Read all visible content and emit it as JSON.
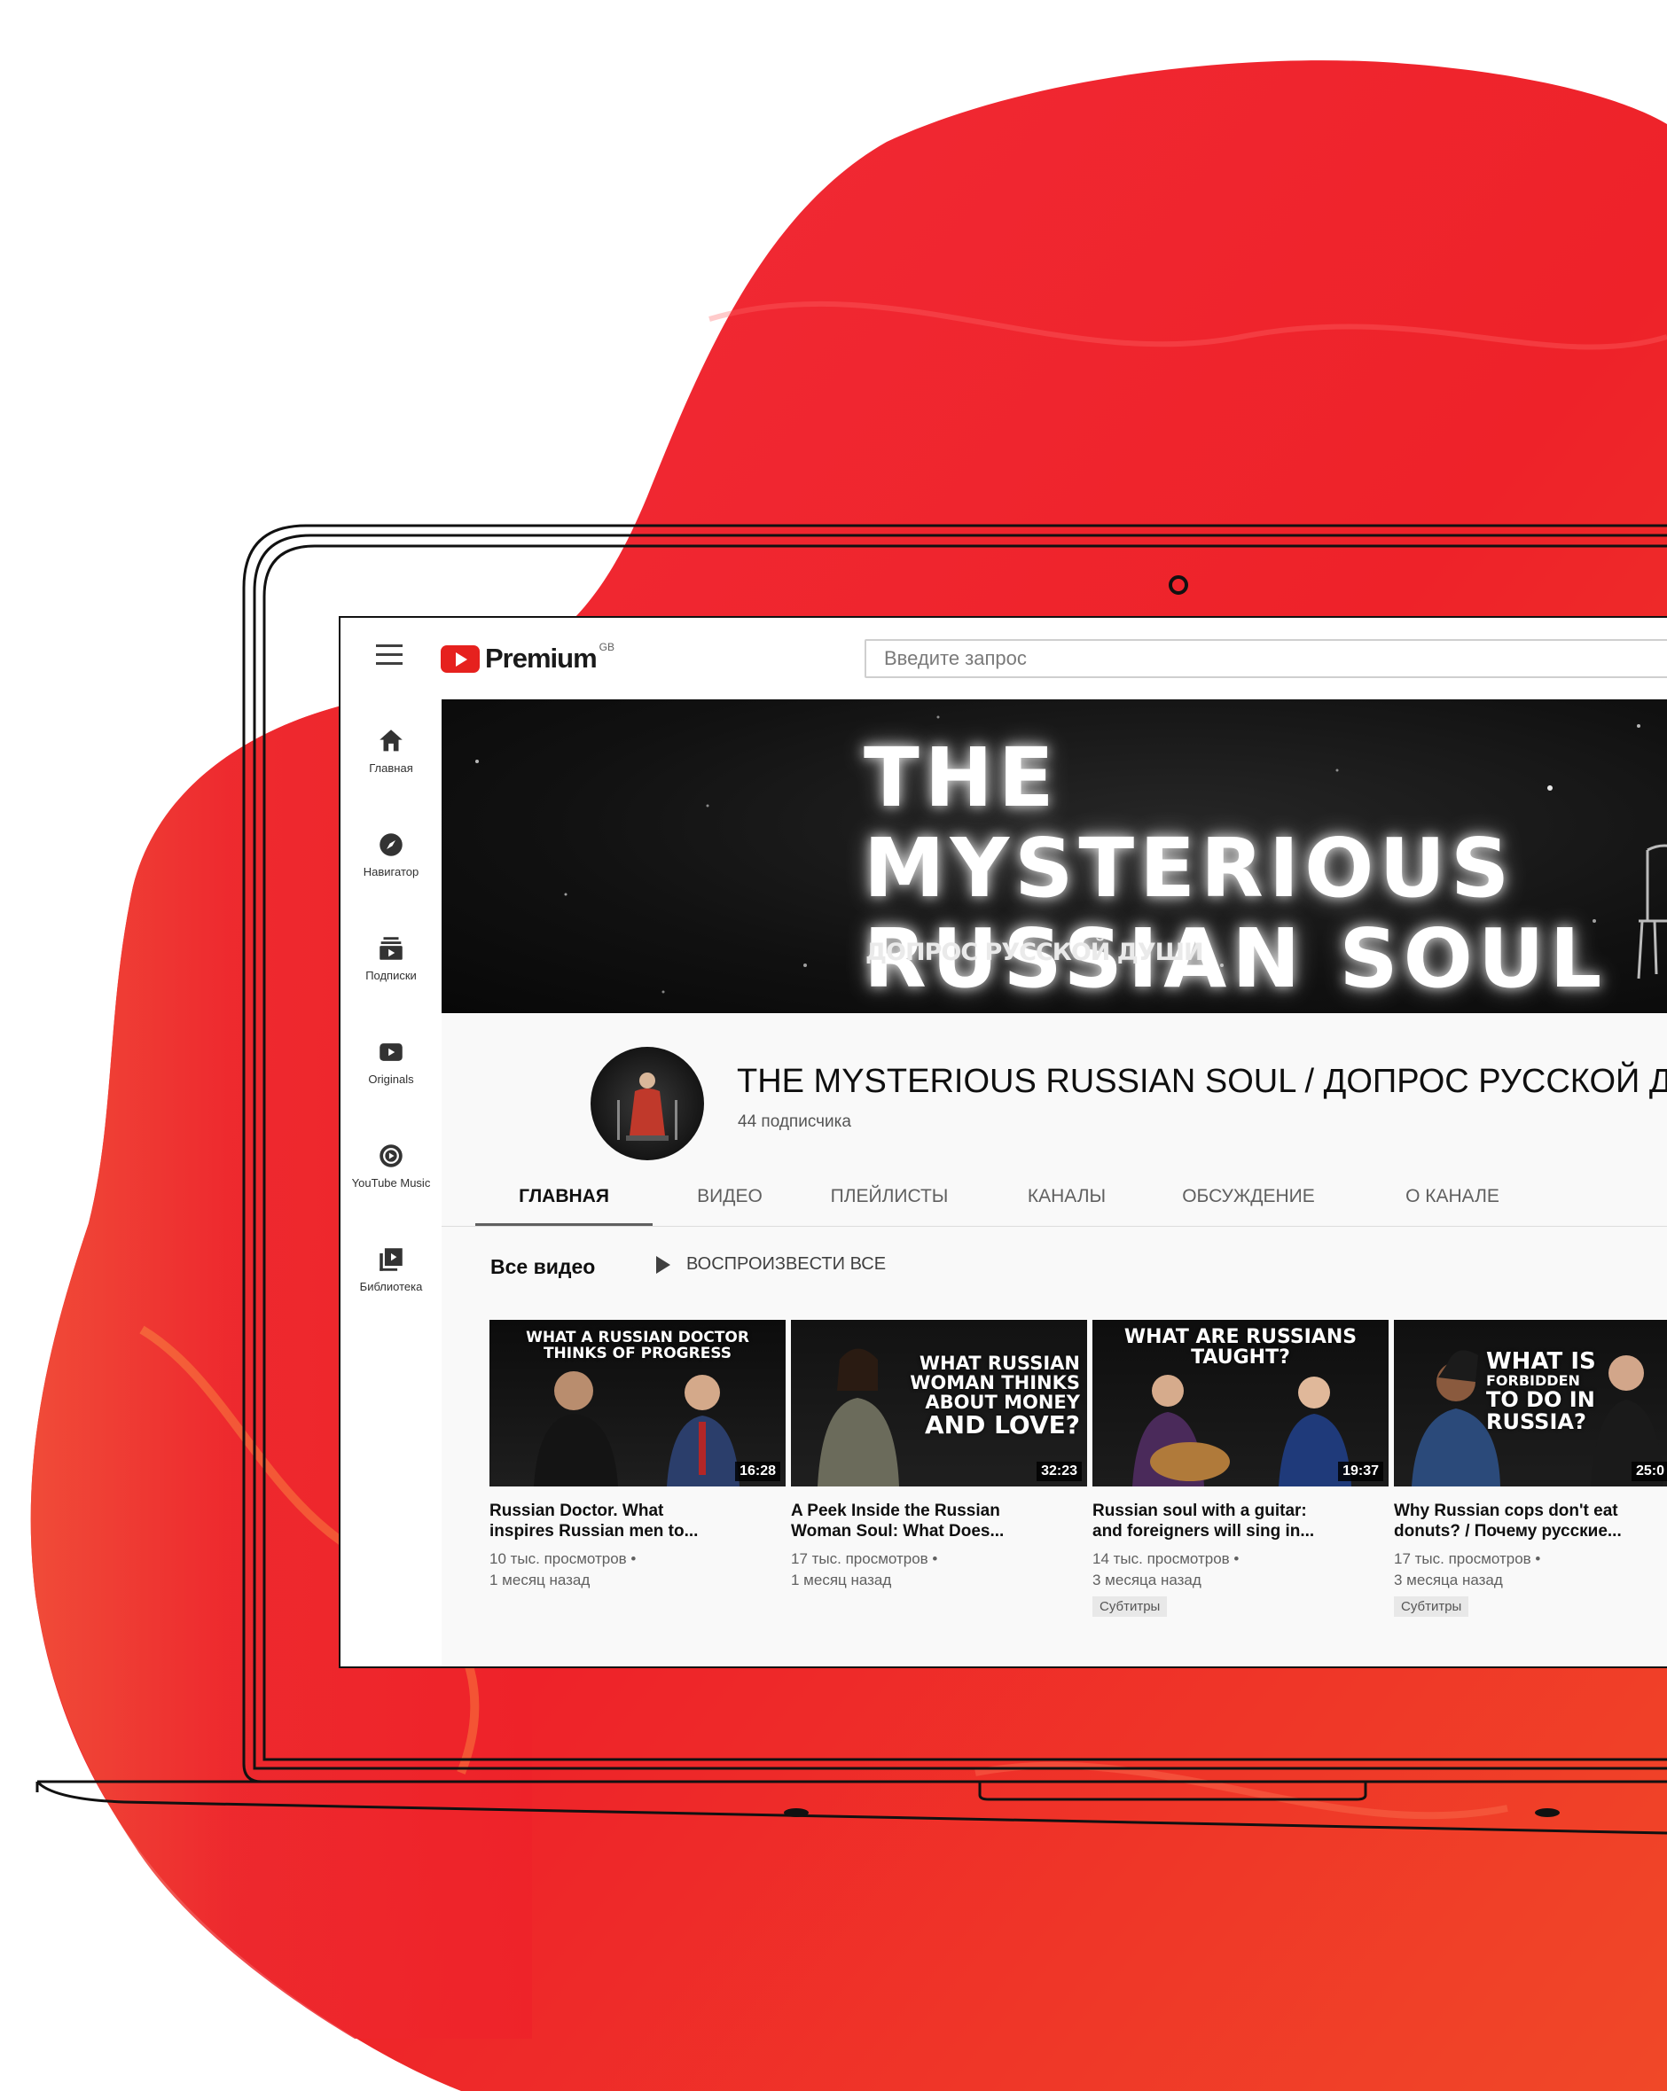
{
  "app": {
    "logo_text": "Premium",
    "logo_region": "GB",
    "search_placeholder": "Введите запрос"
  },
  "sidebar": {
    "items": [
      {
        "label": "Главная",
        "icon": "home-icon"
      },
      {
        "label": "Навигатор",
        "icon": "compass-icon"
      },
      {
        "label": "Подписки",
        "icon": "subscriptions-icon"
      },
      {
        "label": "Originals",
        "icon": "originals-icon"
      },
      {
        "label": "YouTube Music",
        "icon": "music-icon"
      },
      {
        "label": "Библиотека",
        "icon": "library-icon"
      }
    ]
  },
  "banner": {
    "title_line1": "THE MYSTERIOUS",
    "title_line2": "RUSSIAN SOUL",
    "subtitle": "ДОПРОС РУССКОЙ ДУШИ"
  },
  "channel": {
    "name": "THE MYSTERIOUS RUSSIAN SOUL / ДОПРОС РУССКОЙ ДУШ",
    "subscribers": "44 подписчика"
  },
  "tabs": [
    "ГЛАВНАЯ",
    "ВИДЕО",
    "ПЛЕЙЛИСТЫ",
    "КАНАЛЫ",
    "ОБСУЖДЕНИЕ",
    "О КАНАЛЕ"
  ],
  "section": {
    "title": "Все видео",
    "play_all": "ВОСПРОИЗВЕСТИ ВСЕ"
  },
  "videos": [
    {
      "thumb_caption_1": "WHAT A RUSSIAN DOCTOR",
      "thumb_caption_2": "THINKS OF PROGRESS",
      "duration": "16:28",
      "title_1": "Russian Doctor. What",
      "title_2": "inspires Russian men to...",
      "views": "10 тыс. просмотров •",
      "age": "1 месяц назад",
      "badge": ""
    },
    {
      "thumb_caption_1": "WHAT RUSSIAN",
      "thumb_caption_2": "WOMAN THINKS",
      "thumb_caption_3": "ABOUT MONEY",
      "thumb_caption_4": "AND LOVE?",
      "duration": "32:23",
      "title_1": "A Peek Inside the Russian",
      "title_2": "Woman Soul: What Does...",
      "views": "17 тыс. просмотров •",
      "age": "1 месяц назад",
      "badge": ""
    },
    {
      "thumb_caption_1": "WHAT ARE RUSSIANS",
      "thumb_caption_2": "TAUGHT?",
      "duration": "19:37",
      "title_1": "Russian soul with a guitar:",
      "title_2": "and foreigners will sing in...",
      "views": "14 тыс. просмотров •",
      "age": "3 месяца назад",
      "badge": "Субтитры"
    },
    {
      "thumb_caption_1": "WHAT IS",
      "thumb_caption_2": "FORBIDDEN",
      "thumb_caption_3": "TO DO IN",
      "thumb_caption_4": "RUSSIA?",
      "duration": "25:0",
      "title_1": "Why Russian cops don't eat",
      "title_2": "donuts? / Почему русские...",
      "views": "17 тыс. просмотров •",
      "age": "3 месяца назад",
      "badge": "Субтитры"
    }
  ]
}
